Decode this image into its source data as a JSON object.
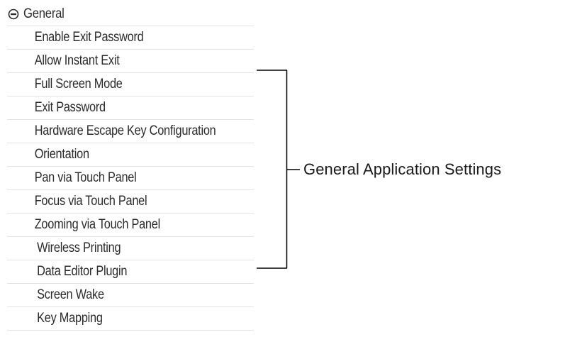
{
  "tree": {
    "group_label": "General",
    "group_icon": "collapse-circle-icon",
    "items": [
      {
        "label": "Enable Exit Password"
      },
      {
        "label": "Allow Instant Exit"
      },
      {
        "label": "Full Screen Mode"
      },
      {
        "label": "Exit Password"
      },
      {
        "label": "Hardware Escape Key Configuration"
      },
      {
        "label": "Orientation"
      },
      {
        "label": "Pan via Touch Panel"
      },
      {
        "label": "Focus via Touch Panel"
      },
      {
        "label": "Zooming via Touch Panel"
      },
      {
        "label": "Wireless Printing"
      },
      {
        "label": "Data Editor Plugin"
      },
      {
        "label": "Screen Wake"
      },
      {
        "label": "Key Mapping"
      }
    ]
  },
  "callout": {
    "label": "General Application Settings"
  },
  "colors": {
    "text": "#2b2b2b",
    "divider": "#e2e2e2",
    "bracket": "#000000"
  }
}
